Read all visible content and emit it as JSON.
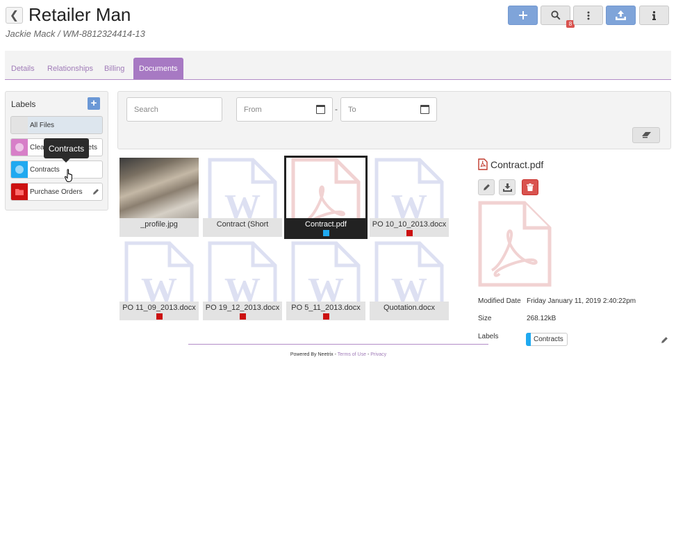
{
  "header": {
    "title": "Retailer Man",
    "subtitle": "Jackie Mack / WM-8812324414-13",
    "badge_count": "8"
  },
  "toolbar": {
    "icons": [
      "plus-icon",
      "search-icon",
      "more-vertical-icon",
      "upload-icon",
      "info-icon"
    ]
  },
  "tabs": [
    {
      "label": "Details"
    },
    {
      "label": "Relationships"
    },
    {
      "label": "Billing"
    },
    {
      "label": "Documents",
      "active": true
    }
  ],
  "labels": {
    "title": "Labels",
    "items": [
      {
        "label": "All Files",
        "color": "#e3e3e3"
      },
      {
        "label": "Clea",
        "label_tail": "ets",
        "color": "#d77fc8"
      },
      {
        "label": "Contracts",
        "color": "#1fa9f0"
      },
      {
        "label": "Purchase Orders",
        "color": "#cc1111"
      }
    ],
    "tooltip": "Contracts"
  },
  "filter": {
    "search_placeholder": "Search",
    "from_placeholder": "From",
    "to_placeholder": "To",
    "range_sep": "-"
  },
  "files": [
    {
      "name": "_profile.jpg",
      "type": "image",
      "marker": null
    },
    {
      "name": "Contract (Short",
      "type": "word",
      "marker": null
    },
    {
      "name": "Contract.pdf",
      "type": "pdf",
      "marker": "#1fa9f0",
      "selected": true
    },
    {
      "name": "PO 10_10_2013.docx",
      "type": "word",
      "marker": "#cc1111"
    },
    {
      "name": "PO 11_09_2013.docx",
      "type": "word",
      "marker": "#cc1111"
    },
    {
      "name": "PO 19_12_2013.docx",
      "type": "word",
      "marker": "#cc1111"
    },
    {
      "name": "PO 5_11_2013.docx",
      "type": "word",
      "marker": "#cc1111"
    },
    {
      "name": "Quotation.docx",
      "type": "word",
      "marker": null
    }
  ],
  "detail": {
    "name": "Contract.pdf",
    "modified_label": "Modified Date",
    "modified_value": "Friday January 11, 2019 2:40:22pm",
    "size_label": "Size",
    "size_value": "268.12kB",
    "labels_label": "Labels",
    "label_chip": "Contracts",
    "label_chip_color": "#1fa9f0"
  },
  "footer": {
    "prefix": "Powered By Neetrix - ",
    "terms": "Terms of Use",
    "sep": " - ",
    "privacy": "Privacy"
  }
}
